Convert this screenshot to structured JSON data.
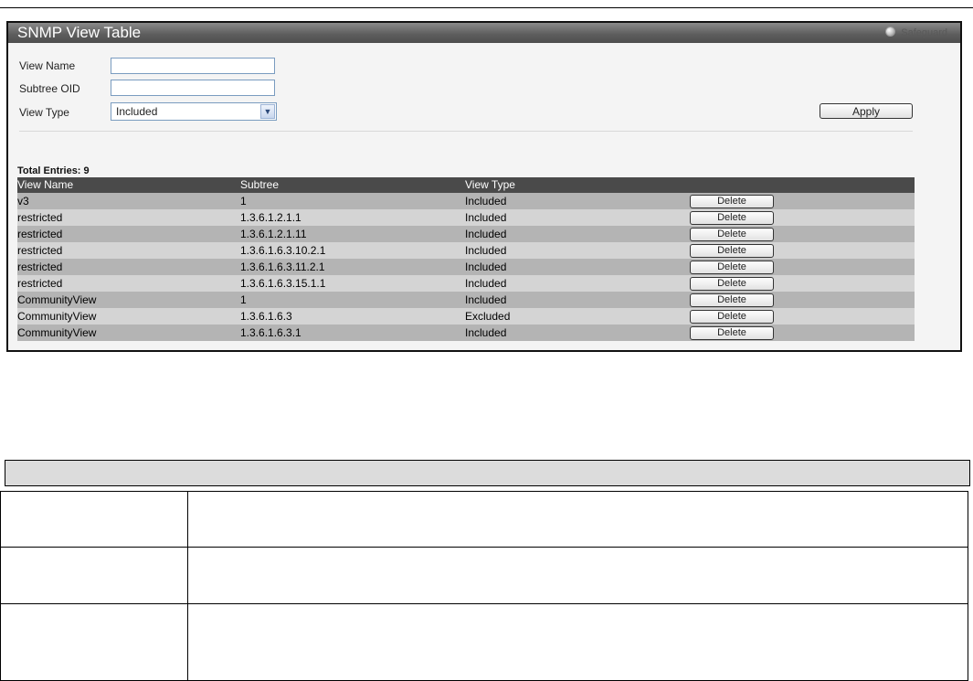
{
  "panel": {
    "title": "SNMP View Table",
    "safeguard_label": "Safeguard"
  },
  "form": {
    "view_name_label": "View Name",
    "view_name_value": "",
    "subtree_oid_label": "Subtree OID",
    "subtree_oid_value": "",
    "view_type_label": "View Type",
    "view_type_selected": "Included",
    "apply_label": "Apply"
  },
  "table": {
    "total_entries": "Total Entries: 9",
    "headers": [
      "View Name",
      "Subtree",
      "View Type"
    ],
    "delete_label": "Delete",
    "rows": [
      {
        "view_name": "v3",
        "subtree": "1",
        "view_type": "Included"
      },
      {
        "view_name": "restricted",
        "subtree": "1.3.6.1.2.1.1",
        "view_type": "Included"
      },
      {
        "view_name": "restricted",
        "subtree": "1.3.6.1.2.1.11",
        "view_type": "Included"
      },
      {
        "view_name": "restricted",
        "subtree": "1.3.6.1.6.3.10.2.1",
        "view_type": "Included"
      },
      {
        "view_name": "restricted",
        "subtree": "1.3.6.1.6.3.11.2.1",
        "view_type": "Included"
      },
      {
        "view_name": "restricted",
        "subtree": "1.3.6.1.6.3.15.1.1",
        "view_type": "Included"
      },
      {
        "view_name": "CommunityView",
        "subtree": "1",
        "view_type": "Included"
      },
      {
        "view_name": "CommunityView",
        "subtree": "1.3.6.1.6.3",
        "view_type": "Excluded"
      },
      {
        "view_name": "CommunityView",
        "subtree": "1.3.6.1.6.3.1",
        "view_type": "Included"
      }
    ]
  }
}
